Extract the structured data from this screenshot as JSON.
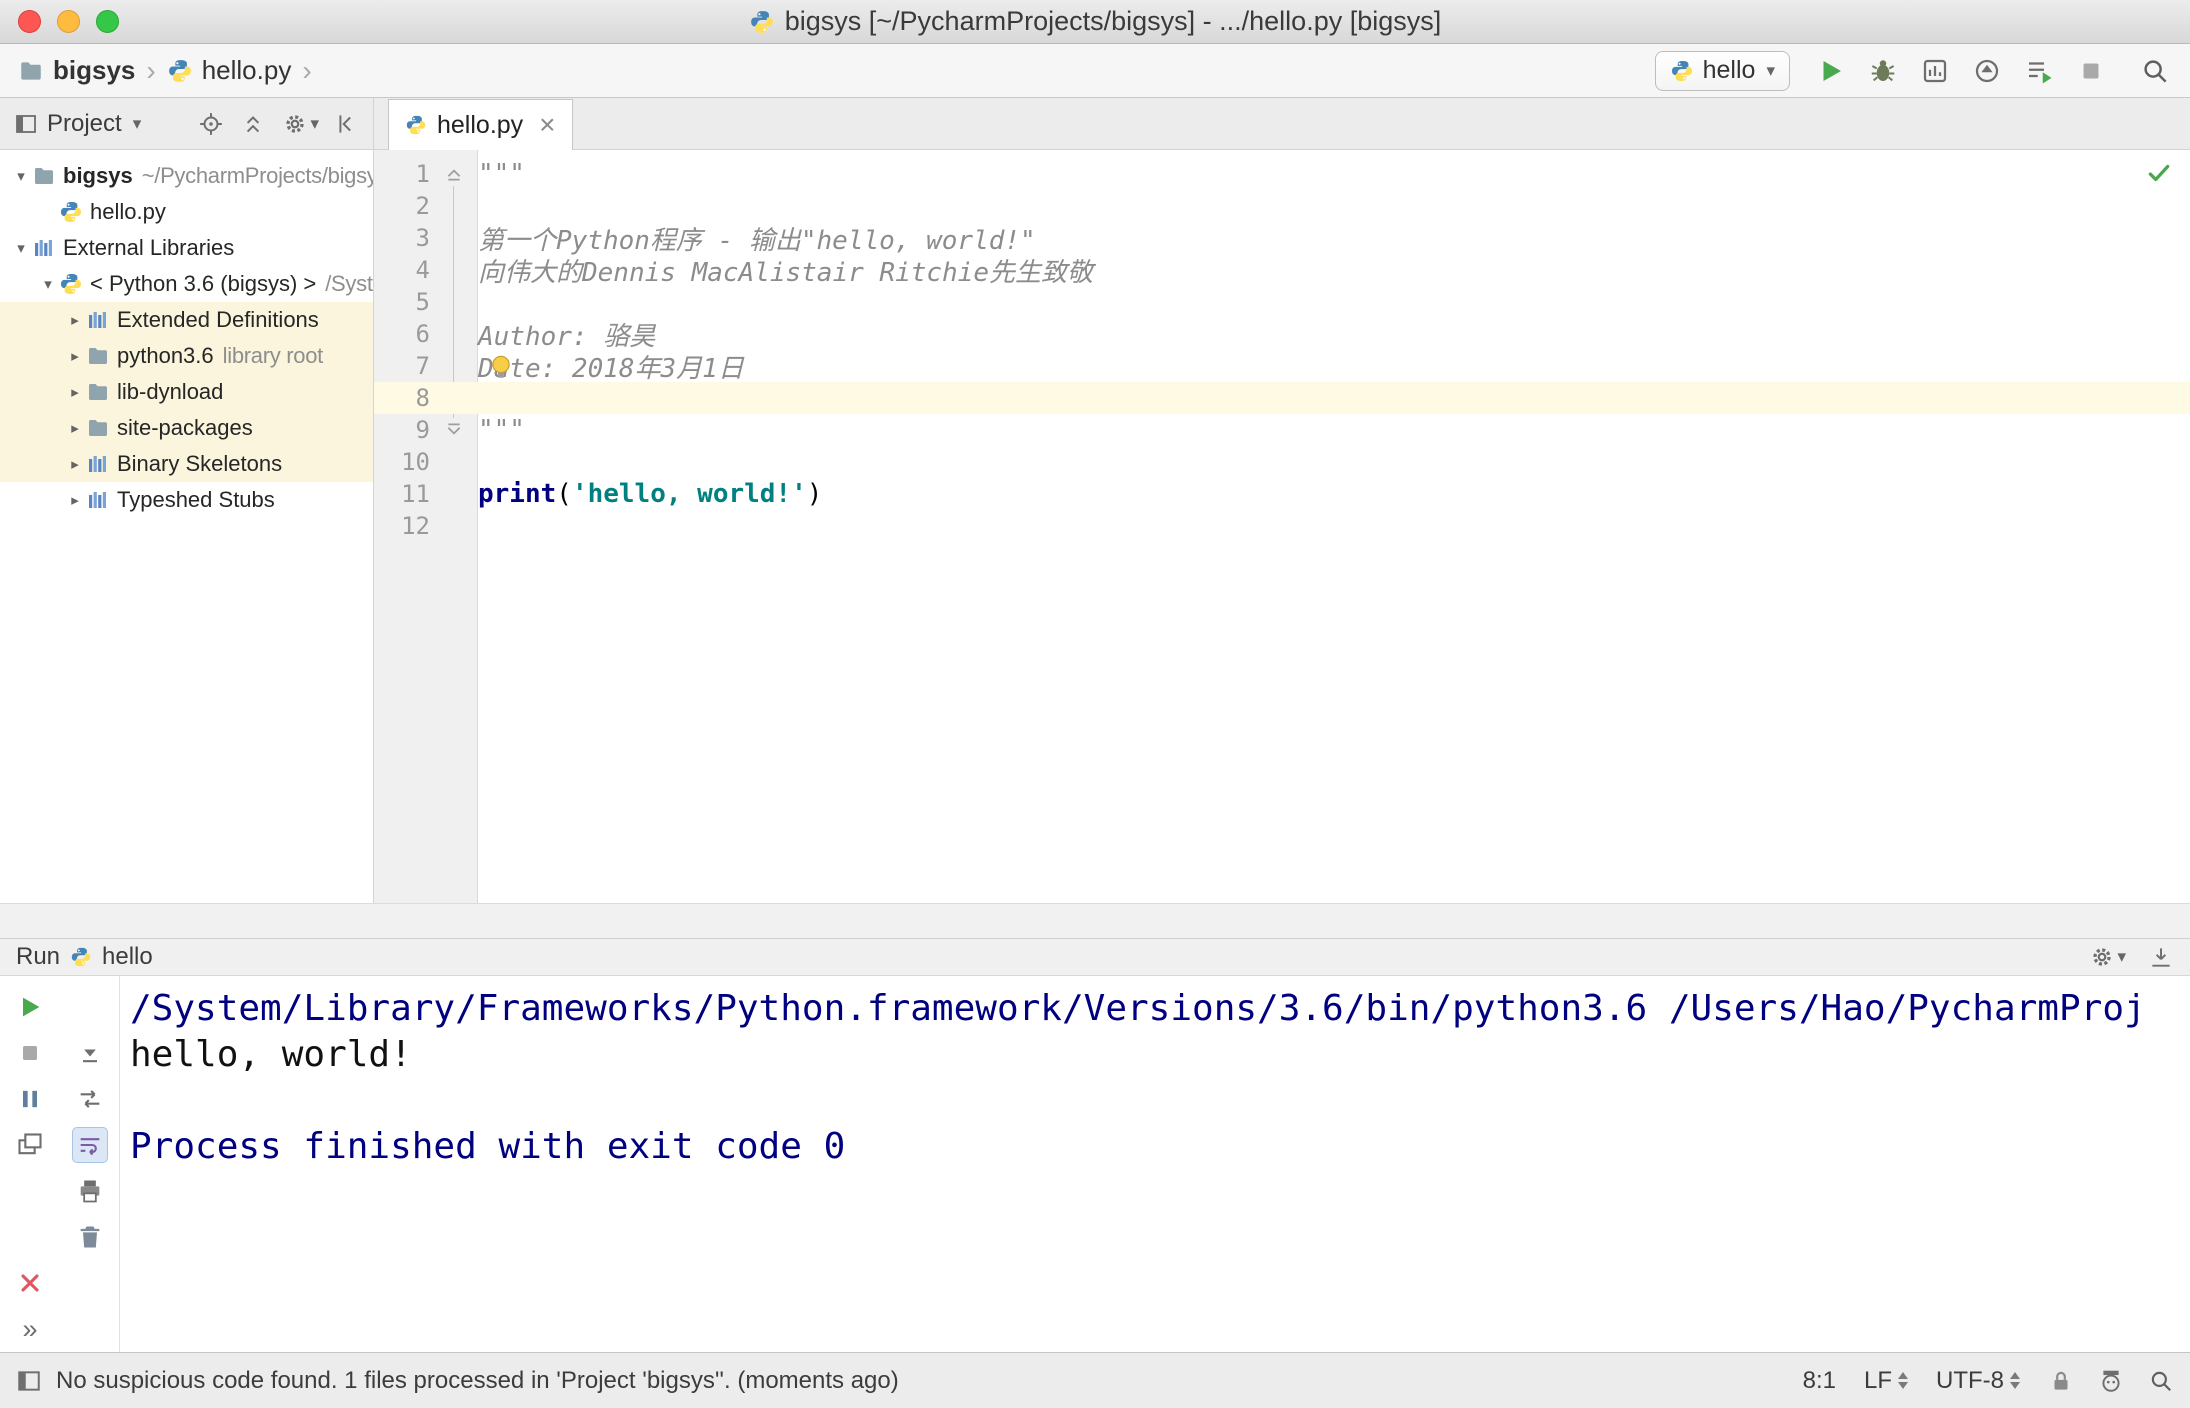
{
  "window": {
    "title": "bigsys [~/PycharmProjects/bigsys] - .../hello.py [bigsys]"
  },
  "navbar": {
    "breadcrumbs": [
      {
        "label": "bigsys",
        "icon": "folder"
      },
      {
        "label": "hello.py",
        "icon": "python"
      }
    ],
    "run_config": {
      "icon": "python",
      "label": "hello"
    },
    "actions": [
      {
        "icon": "play",
        "name": "run"
      },
      {
        "icon": "bug",
        "name": "debug"
      },
      {
        "icon": "coverage",
        "name": "run-with-coverage"
      },
      {
        "icon": "profiler",
        "name": "profiler"
      },
      {
        "icon": "concurrency",
        "name": "concurrency-diagram"
      },
      {
        "icon": "stop",
        "name": "stop"
      },
      {
        "icon": "search",
        "name": "search-everywhere"
      }
    ]
  },
  "project_panel": {
    "title": "Project",
    "actions": [
      {
        "icon": "target",
        "name": "select-opened-file"
      },
      {
        "icon": "collapse-all",
        "name": "collapse-all"
      },
      {
        "icon": "gear",
        "name": "settings",
        "dropdown": true
      },
      {
        "icon": "hide",
        "name": "hide-panel"
      }
    ],
    "tree": [
      {
        "label": "bigsys",
        "suffix": "~/PycharmProjects/bigsys",
        "icon": "folder",
        "expanded": true,
        "indent": 0,
        "bold": true
      },
      {
        "label": "hello.py",
        "icon": "python",
        "indent": 1
      },
      {
        "label": "External Libraries",
        "icon": "library",
        "expanded": true,
        "indent": 0
      },
      {
        "label": "< Python 3.6 (bigsys) >",
        "suffix": "/System",
        "icon": "python",
        "expanded": true,
        "indent": 1
      },
      {
        "label": "Extended Definitions",
        "icon": "library",
        "expanded": false,
        "indent": 2,
        "highlight": true
      },
      {
        "label": "python3.6",
        "suffix": "library root",
        "icon": "folder",
        "expanded": false,
        "indent": 2,
        "highlight": true
      },
      {
        "label": "lib-dynload",
        "icon": "folder",
        "expanded": false,
        "indent": 2,
        "highlight": true
      },
      {
        "label": "site-packages",
        "icon": "folder",
        "expanded": false,
        "indent": 2,
        "highlight": true
      },
      {
        "label": "Binary Skeletons",
        "icon": "library",
        "expanded": false,
        "indent": 2,
        "highlight": true
      },
      {
        "label": "Typeshed Stubs",
        "icon": "library",
        "expanded": false,
        "indent": 2
      }
    ]
  },
  "editor": {
    "tab": {
      "label": "hello.py",
      "icon": "python"
    },
    "lines": [
      {
        "num": 1,
        "fold": "top",
        "segments": [
          {
            "style": "doc",
            "text": "\"\"\""
          }
        ]
      },
      {
        "num": 2,
        "segments": []
      },
      {
        "num": 3,
        "segments": [
          {
            "style": "doc",
            "text": "第一个Python程序 - 输出\"hello, world!\""
          }
        ]
      },
      {
        "num": 4,
        "segments": [
          {
            "style": "doc",
            "text": "向伟大的Dennis MacAlistair Ritchie先生致敬"
          }
        ]
      },
      {
        "num": 5,
        "segments": []
      },
      {
        "num": 6,
        "segments": [
          {
            "style": "doc",
            "text": "Author: 骆昊"
          }
        ]
      },
      {
        "num": 7,
        "segments": [
          {
            "style": "doc",
            "text": "Date: 2018年3月1日"
          }
        ]
      },
      {
        "num": 8,
        "current": true,
        "segments": []
      },
      {
        "num": 9,
        "fold": "bottom",
        "segments": [
          {
            "style": "doc",
            "text": "\"\"\""
          }
        ]
      },
      {
        "num": 10,
        "segments": []
      },
      {
        "num": 11,
        "segments": [
          {
            "style": "kw",
            "text": "print"
          },
          {
            "style": "plain",
            "text": "("
          },
          {
            "style": "str",
            "text": "'hello, world!'"
          },
          {
            "style": "plain",
            "text": ")"
          }
        ]
      },
      {
        "num": 12,
        "segments": []
      }
    ]
  },
  "run_panel": {
    "title": "Run",
    "config": {
      "icon": "python",
      "label": "hello"
    },
    "actions": [
      {
        "icon": "gear",
        "name": "settings",
        "dropdown": true
      },
      {
        "icon": "dock",
        "name": "dock-panel"
      }
    ],
    "toolbar": [
      {
        "icon": "play",
        "name": "rerun",
        "row": 1,
        "col": 1
      },
      {
        "icon": "stop",
        "name": "stop",
        "row": 2,
        "col": 1
      },
      {
        "icon": "scroll-down",
        "name": "scroll-to-end",
        "row": 2,
        "col": 2
      },
      {
        "icon": "pause",
        "name": "pause-output",
        "row": 3,
        "col": 1
      },
      {
        "icon": "restore",
        "name": "restore-layout",
        "row": 3,
        "col": 2
      },
      {
        "icon": "windows",
        "name": "show-console",
        "row": 4,
        "col": 1
      },
      {
        "icon": "softwrap",
        "name": "soft-wrap",
        "row": 4,
        "col": 2,
        "active": true
      },
      {
        "icon": "printer",
        "name": "print-console",
        "row": 5,
        "col": 2
      },
      {
        "icon": "trash",
        "name": "clear-all",
        "row": 6,
        "col": 2
      },
      {
        "icon": "close-red",
        "name": "close-panel",
        "row": 7,
        "col": 1
      },
      {
        "icon": "chevrons",
        "name": "more-actions",
        "row": 8,
        "col": 1
      }
    ],
    "console": [
      {
        "style": "sys",
        "text": "/System/Library/Frameworks/Python.framework/Versions/3.6/bin/python3.6 /Users/Hao/PycharmProj"
      },
      {
        "style": "out",
        "text": "hello, world!"
      },
      {
        "style": "out",
        "text": ""
      },
      {
        "style": "sys",
        "text": "Process finished with exit code 0"
      }
    ]
  },
  "status_bar": {
    "message": "No suspicious code found. 1 files processed in 'Project 'bigsys''. (moments ago)",
    "position": "8:1",
    "line_separator": "LF",
    "encoding": "UTF-8",
    "icons": [
      {
        "icon": "lock",
        "name": "read-only-toggle"
      },
      {
        "icon": "hector",
        "name": "highlighting-level"
      },
      {
        "icon": "search",
        "name": "zoom"
      }
    ]
  },
  "colors": {
    "run_green": "#49A94E",
    "keyword": "#000080",
    "string": "#008080",
    "docstring": "#8C8C8C",
    "library_row_highlight": "#FAF5DC",
    "current_line": "#FFFAE3",
    "console_system": "#000080",
    "close_red": "#E0565E"
  }
}
